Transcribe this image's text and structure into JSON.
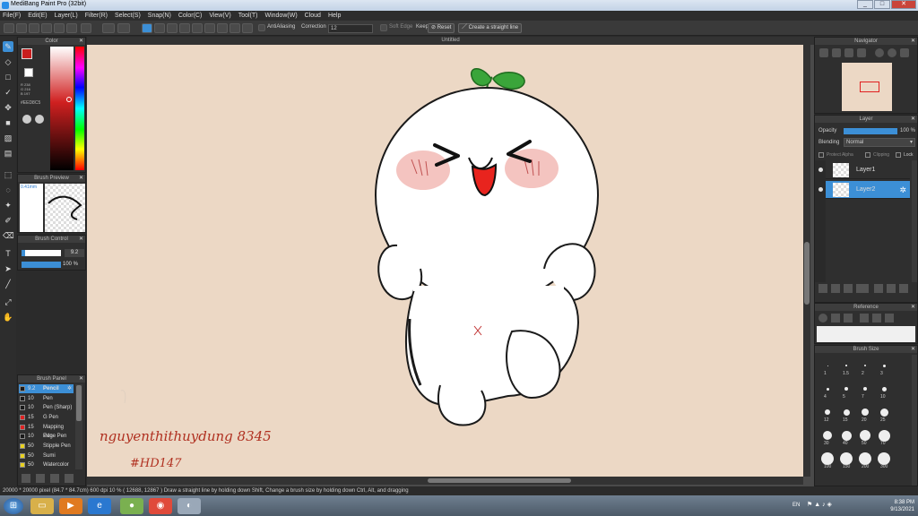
{
  "window": {
    "title": "MediBang Paint Pro (32bit)",
    "min": "_",
    "max": "□",
    "close": "✕"
  },
  "menu": [
    "File(F)",
    "Edit(E)",
    "Layer(L)",
    "Filter(R)",
    "Select(S)",
    "Snap(N)",
    "Color(C)",
    "View(V)",
    "Tool(T)",
    "Window(W)",
    "Cloud",
    "Help"
  ],
  "toolbar": {
    "antialiasing": "AntiAliasing",
    "correction_label": "Correction",
    "correction_value": "12",
    "soft_edge": "Soft Edge",
    "keep": "Keep",
    "reset": "Reset",
    "straight": "Create a straight line"
  },
  "doc": {
    "title": "Untitled"
  },
  "panels": {
    "color": "Color",
    "brush_preview": "Brush Preview",
    "brush_preview_size": "0.41mm",
    "brush_control": "Brush Control",
    "brush_size": "9.2",
    "brush_opacity": "100 %",
    "brush_panel": "Brush Panel",
    "navigator": "Navigator",
    "layer": "Layer",
    "reference": "Reference",
    "brush_size_panel": "Brush Size"
  },
  "color_info": {
    "line1": "R 238",
    "line2": "G 216",
    "line3": "B 197",
    "hex": "#EED8C5"
  },
  "brushes": [
    {
      "size": "9.2",
      "name": "Pencil",
      "color": "#1a1a1a",
      "selected": true
    },
    {
      "size": "10",
      "name": "Pen",
      "color": "#1a1a1a"
    },
    {
      "size": "10",
      "name": "Pen (Sharp)",
      "color": "#1a1a1a"
    },
    {
      "size": "15",
      "name": "G Pen",
      "color": "#dd2222"
    },
    {
      "size": "15",
      "name": "Mapping Pen",
      "color": "#dd2222"
    },
    {
      "size": "10",
      "name": "Edge Pen",
      "color": "#1a1a1a"
    },
    {
      "size": "50",
      "name": "Stipple Pen",
      "color": "#e8d020"
    },
    {
      "size": "50",
      "name": "Sumi",
      "color": "#e8d020"
    },
    {
      "size": "50",
      "name": "Watercolor",
      "color": "#e8d020"
    }
  ],
  "layer": {
    "opacity_label": "Opacity",
    "opacity_value": "100 %",
    "opacity_fraction": 1.0,
    "blending_label": "Blending",
    "blending_value": "Normal",
    "protect_alpha": "Protect Alpha",
    "clipping": "Clipping",
    "lock": "Lock",
    "layers": [
      {
        "name": "Layer1"
      },
      {
        "name": "Layer2",
        "selected": true
      }
    ]
  },
  "brush_sizes": [
    "1",
    "1.5",
    "2",
    "3",
    "4",
    "5",
    "7",
    "10",
    "12",
    "15",
    "20",
    "25",
    "30",
    "40",
    "50",
    "70",
    "100",
    "150",
    "200",
    "300"
  ],
  "signature": {
    "line1": "nguyenthithuydung 8345",
    "line2": "#HD147"
  },
  "status": "20000 * 20000 pixel  (84.7 * 84.7cm)  600 dpi  10 %  ( 12688, 12867 )  Draw a straight line by holding down Shift, Change a brush size by holding down Ctrl, Alt, and dragging",
  "tray": {
    "lang": "EN",
    "time": "8:38 PM",
    "date": "9/13/2021"
  }
}
